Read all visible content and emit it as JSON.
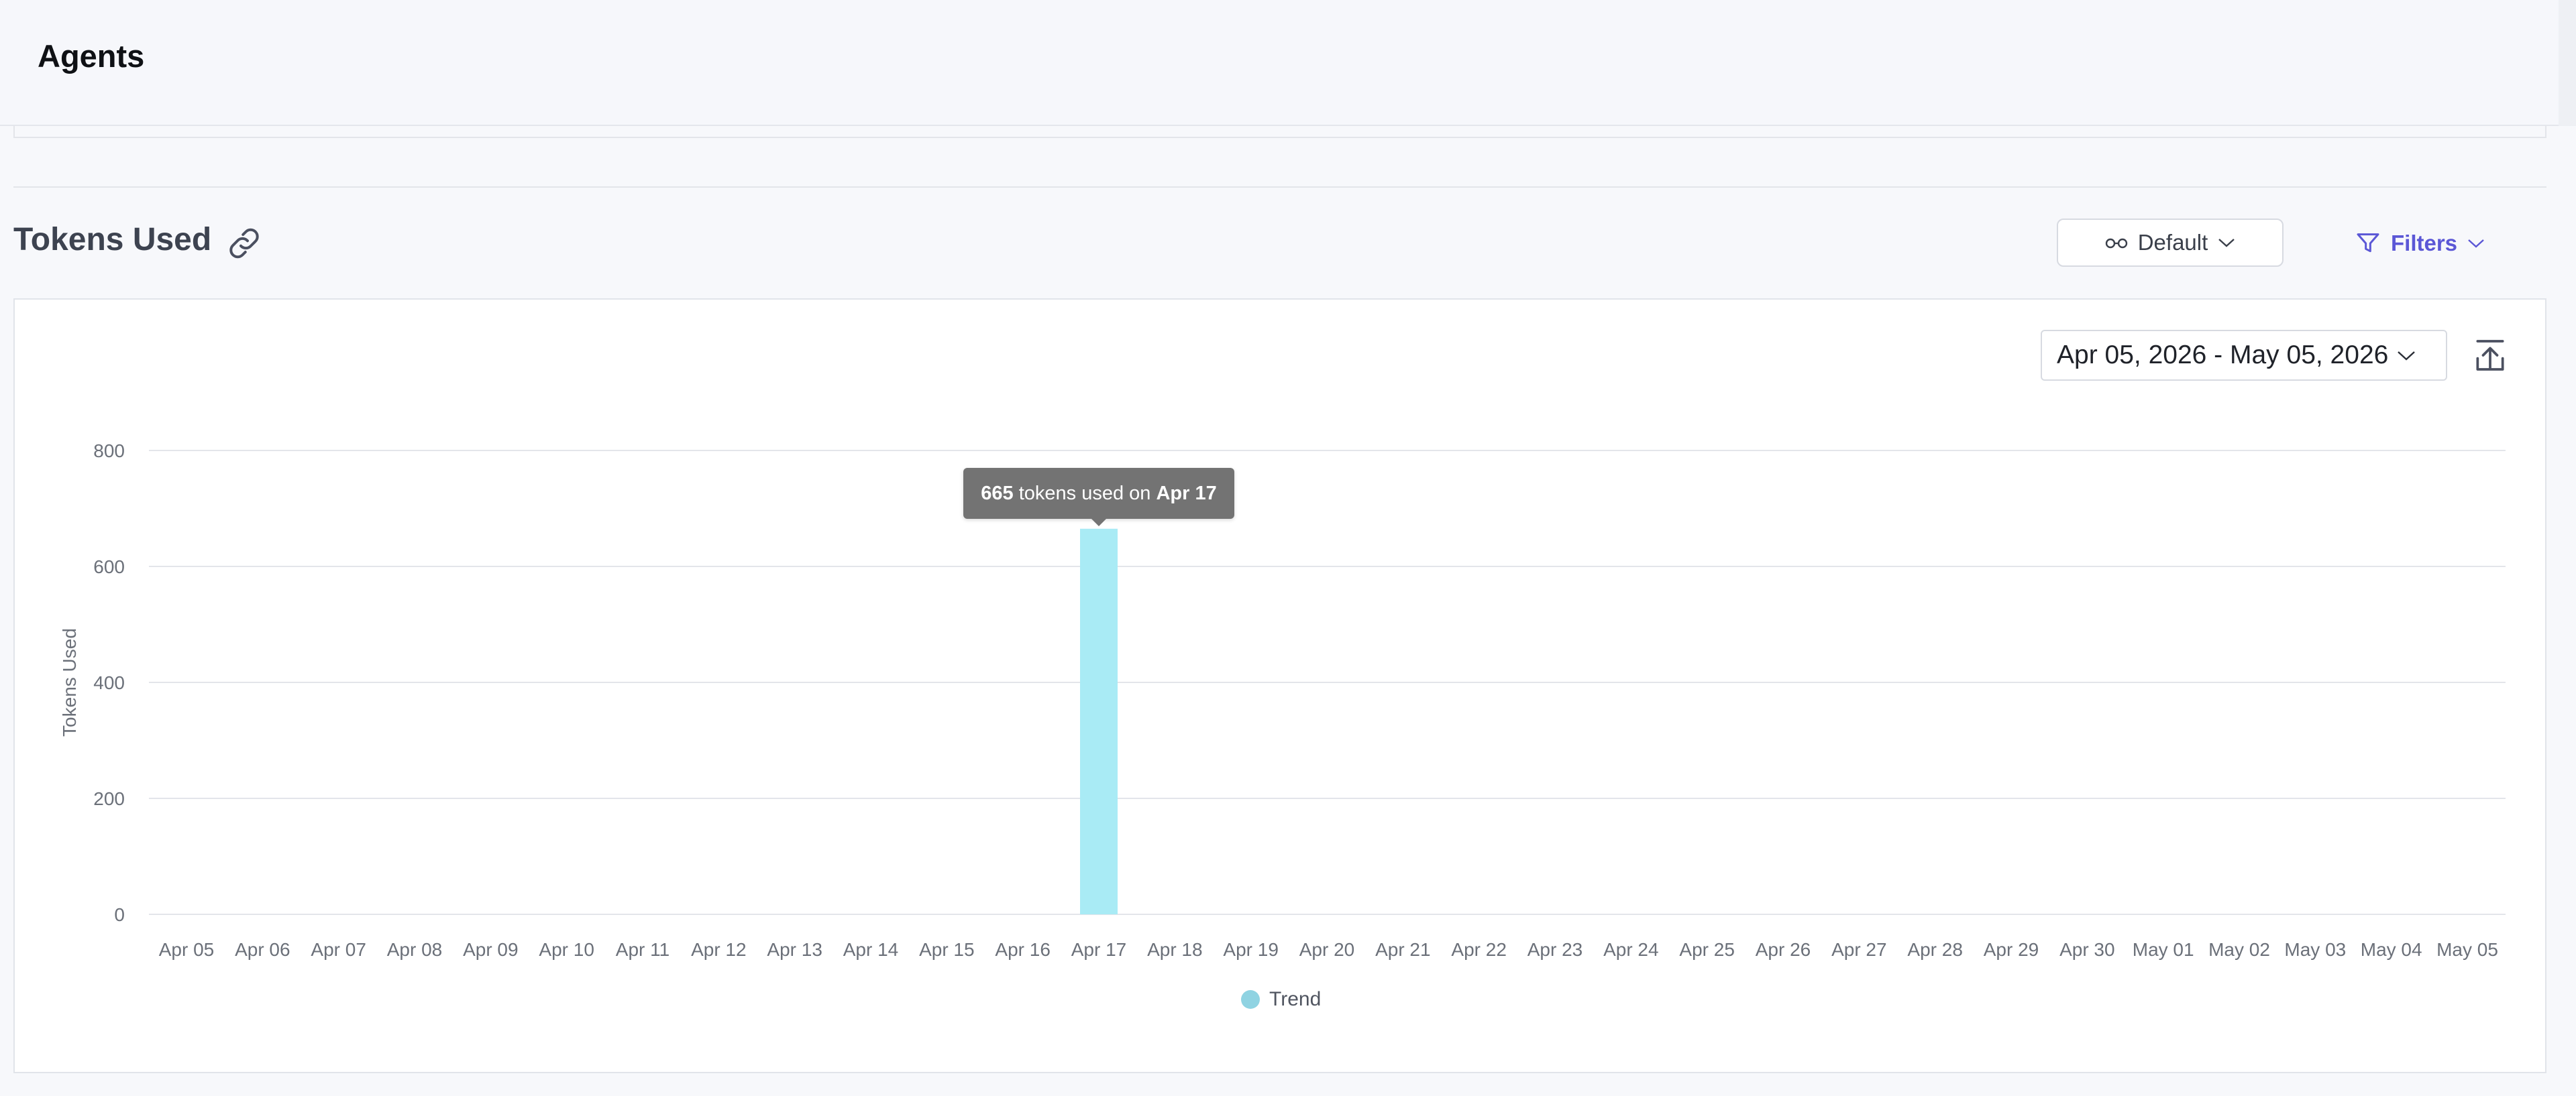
{
  "header": {
    "title": "Agents"
  },
  "section": {
    "title": "Tokens Used",
    "link_icon": "link-icon"
  },
  "controls": {
    "view_label": "Default",
    "view_icon": "glasses-icon",
    "filters_label": "Filters",
    "filters_icon": "funnel-icon",
    "date_range": "Apr 05, 2026 - May 05, 2026",
    "export_icon": "export-icon"
  },
  "tooltip": {
    "value": "665",
    "middle": " tokens used on ",
    "date": "Apr 17"
  },
  "colors": {
    "bar": "#a9ebf5",
    "legend_dot": "#8fd3e2",
    "accent": "#5b57d6"
  },
  "chart_data": {
    "type": "bar",
    "ylabel": "Tokens Used",
    "xlabel": "",
    "ylim": [
      0,
      800
    ],
    "yticks": [
      0,
      200,
      400,
      600,
      800
    ],
    "grid": true,
    "legend_position": "bottom-center",
    "categories": [
      "Apr 05",
      "Apr 06",
      "Apr 07",
      "Apr 08",
      "Apr 09",
      "Apr 10",
      "Apr 11",
      "Apr 12",
      "Apr 13",
      "Apr 14",
      "Apr 15",
      "Apr 16",
      "Apr 17",
      "Apr 18",
      "Apr 19",
      "Apr 20",
      "Apr 21",
      "Apr 22",
      "Apr 23",
      "Apr 24",
      "Apr 25",
      "Apr 26",
      "Apr 27",
      "Apr 28",
      "Apr 29",
      "Apr 30",
      "May 01",
      "May 02",
      "May 03",
      "May 04",
      "May 05"
    ],
    "series": [
      {
        "name": "Trend",
        "values": [
          0,
          0,
          0,
          0,
          0,
          0,
          0,
          0,
          0,
          0,
          0,
          0,
          665,
          0,
          0,
          0,
          0,
          0,
          0,
          0,
          0,
          0,
          0,
          0,
          0,
          0,
          0,
          0,
          0,
          0,
          0
        ]
      }
    ]
  }
}
